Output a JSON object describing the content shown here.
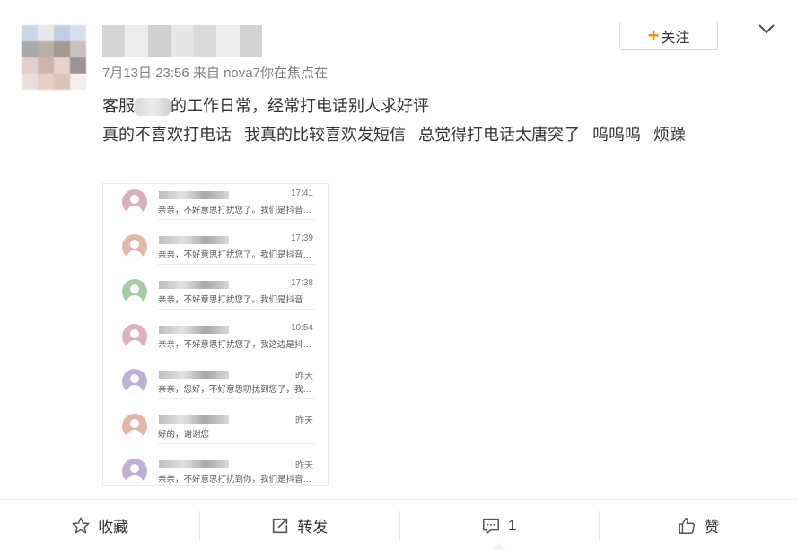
{
  "post": {
    "timestamp": "7月13日 23:56",
    "source_prefix": "来自",
    "source": "nova7你在焦点在",
    "line1_a": "客服",
    "line1_b": "的工作日常，经常打电话别人求好评",
    "line2_parts": [
      "真的不喜欢打电话",
      "我真的比较喜欢发短信",
      "总觉得打电话太唐突了",
      "呜呜呜",
      "烦躁"
    ]
  },
  "follow_label": "关注",
  "messages": [
    {
      "time": "17:41",
      "preview": "亲亲，不好意思打扰您了。我们是抖音…",
      "avatar_color": "#d9aebd"
    },
    {
      "time": "17:39",
      "preview": "亲亲，不好意思打扰您了。我们是抖音…",
      "avatar_color": "#e2b7ac"
    },
    {
      "time": "17:38",
      "preview": "亲亲，不好意思打扰您了。我们是抖音…",
      "avatar_color": "#a9cca8"
    },
    {
      "time": "10:54",
      "preview": "亲亲，不好意思打扰您了，我这边是抖…",
      "avatar_color": "#dfb2c2"
    },
    {
      "time": "昨天",
      "preview": "亲亲，您好，不好意思叨扰到您了，我…",
      "avatar_color": "#bfb0d6"
    },
    {
      "time": "昨天",
      "preview": "好的，谢谢您",
      "avatar_color": "#e4b6a9"
    },
    {
      "time": "昨天",
      "preview": "亲亲，不好意思打扰到你，我们是抖音…",
      "avatar_color": "#bfb0d6"
    }
  ],
  "actions": {
    "favorite": "收藏",
    "repost": "转发",
    "comment_count": "1",
    "like": "赞"
  },
  "colors": {
    "accent": "#ff8200",
    "meta_text": "#808080"
  }
}
